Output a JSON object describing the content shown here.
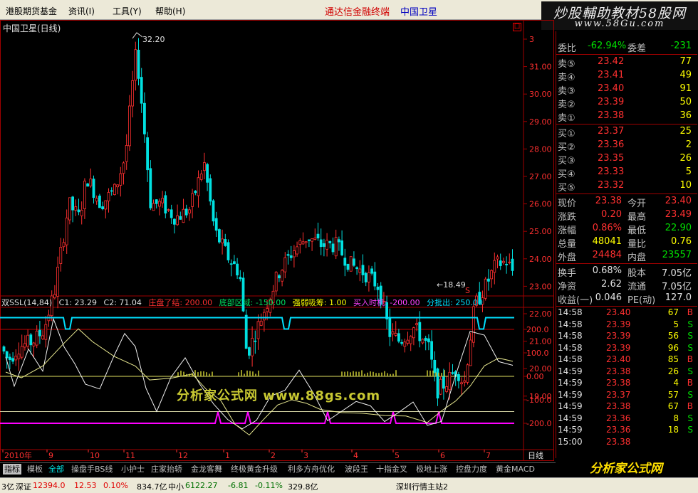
{
  "menu": {
    "items": [
      "港股期货基金",
      "资讯(I)",
      "工具(Y)",
      "帮助(H)"
    ],
    "title_left": "通达信金融终端",
    "title_right": "中国卫星"
  },
  "brand": {
    "line1": "炒股輔助教材58股网",
    "line2": "www.58Gu.com"
  },
  "chart": {
    "title": "中国卫星(日线)",
    "box_label": "口",
    "high_label": "32.20",
    "low_label": "←18.49",
    "s_label": "S",
    "price_ticks": [
      "3",
      "31.00",
      "30.00",
      "29.00",
      "28.00",
      "27.00",
      "26.00",
      "25.00",
      "24.00",
      "23.00",
      "22.00",
      "21.00",
      "20.00",
      "19.00"
    ],
    "ind_ticks": [
      "200.0",
      "100.0",
      "0.00",
      "-100.0",
      "-200.0"
    ],
    "date_labels": [
      "2010年",
      "9",
      "10",
      "11",
      "12",
      "1",
      "2",
      "3",
      "4",
      "5",
      "6",
      "7"
    ],
    "period_label": "日线",
    "colors": {
      "up": "#ff3030",
      "down": "#00e0e0",
      "cyan_line": "#00e0ff",
      "magenta_line": "#ff00ff",
      "yellow_line": "#e0e060",
      "red_line": "#c00000"
    }
  },
  "indicator": {
    "name": "双SSL(14,84)",
    "c1": "C1: 23.29",
    "c2": "C2: 71.04",
    "l1": "庄盘了结: 200.00",
    "l2": "底部区域: -150.00",
    "l3": "强弱吸筹: 1.00",
    "l4": "买入时机: -200.00",
    "l5": "分批出: 250.00"
  },
  "watermark": "分析家公式网 www.88gs.com",
  "chart_data": {
    "type": "candlestick",
    "title": "中国卫星(日线)",
    "ylim": [
      18.49,
      32.2
    ],
    "high": 32.2,
    "low": 18.49,
    "x_labels": [
      "2010年",
      "9",
      "10",
      "11",
      "12",
      "1",
      "2",
      "3",
      "4",
      "5",
      "6",
      "7"
    ],
    "indicator": {
      "name": "双SSL(14,84)",
      "ylim": [
        -250,
        250
      ],
      "levels": [
        250,
        200,
        0,
        -150,
        -200
      ]
    }
  },
  "tabs": [
    "指标",
    "模板",
    "全部",
    "操盘手BS线",
    "小护士",
    "庄家抬轿",
    "金龙客舞",
    "终极黄金升级",
    "利多方舟优化",
    "波段王",
    "十指金叉",
    "极地上涨",
    "控盘力度",
    "黄金MACD"
  ],
  "status": {
    "s0": "3亿",
    "s1_label": "深证",
    "s1_val": "12394.0",
    "s1_chg": "12.53",
    "s1_pct": "0.10%",
    "s1_amt": "834.7亿",
    "s2_label": "中小",
    "s2_val": "6122.27",
    "s2_chg": "-6.81",
    "s2_pct": "-0.11%",
    "s2_amt": "329.8亿",
    "station": "深圳行情主站2"
  },
  "logo": "分析家公式网",
  "quote": {
    "weibi": {
      "label": "委比",
      "val": "-62.94%",
      "label2": "委差",
      "val2": "-231"
    },
    "asks": [
      {
        "label": "卖⑤",
        "price": "23.42",
        "vol": "77"
      },
      {
        "label": "卖④",
        "price": "23.41",
        "vol": "49"
      },
      {
        "label": "卖③",
        "price": "23.40",
        "vol": "91"
      },
      {
        "label": "卖②",
        "price": "23.39",
        "vol": "50"
      },
      {
        "label": "卖①",
        "price": "23.38",
        "vol": "36"
      }
    ],
    "bids": [
      {
        "label": "买①",
        "price": "23.37",
        "vol": "25"
      },
      {
        "label": "买②",
        "price": "23.36",
        "vol": "2"
      },
      {
        "label": "买③",
        "price": "23.35",
        "vol": "26"
      },
      {
        "label": "买④",
        "price": "23.33",
        "vol": "5"
      },
      {
        "label": "买⑤",
        "price": "23.32",
        "vol": "10"
      }
    ],
    "stats": [
      {
        "l1": "现价",
        "v1": "23.38",
        "c1": "q-red",
        "l2": "今开",
        "v2": "23.40",
        "c2": "q-red"
      },
      {
        "l1": "涨跌",
        "v1": "0.20",
        "c1": "q-red",
        "l2": "最高",
        "v2": "23.49",
        "c2": "q-red"
      },
      {
        "l1": "涨幅",
        "v1": "0.86%",
        "c1": "q-red",
        "l2": "最低",
        "v2": "22.90",
        "c2": "q-grn"
      },
      {
        "l1": "总量",
        "v1": "48041",
        "c1": "q-yel",
        "l2": "量比",
        "v2": "0.76",
        "c2": "q-yel"
      },
      {
        "l1": "外盘",
        "v1": "24484",
        "c1": "q-red",
        "l2": "内盘",
        "v2": "23557",
        "c2": "q-grn"
      }
    ],
    "stats2": [
      {
        "l1": "换手",
        "v1": "0.68%",
        "l2": "股本",
        "v2": "7.05亿"
      },
      {
        "l1": "净资",
        "v1": "2.62",
        "l2": "流通",
        "v2": "7.05亿"
      },
      {
        "l1": "收益(一)",
        "v1": "0.046",
        "l2": "PE(动)",
        "v2": "127.0"
      }
    ],
    "ticks": [
      {
        "t": "14:58",
        "p": "23.40",
        "v": "67",
        "s": "B"
      },
      {
        "t": "14:58",
        "p": "23.39",
        "v": "5",
        "s": "S"
      },
      {
        "t": "14:58",
        "p": "23.39",
        "v": "56",
        "s": "S"
      },
      {
        "t": "14:58",
        "p": "23.39",
        "v": "96",
        "s": "S"
      },
      {
        "t": "14:58",
        "p": "23.40",
        "v": "85",
        "s": "B"
      },
      {
        "t": "14:59",
        "p": "23.38",
        "v": "26",
        "s": "S"
      },
      {
        "t": "14:59",
        "p": "23.38",
        "v": "4",
        "s": "B"
      },
      {
        "t": "14:59",
        "p": "23.37",
        "v": "57",
        "s": "S"
      },
      {
        "t": "14:59",
        "p": "23.38",
        "v": "67",
        "s": "B"
      },
      {
        "t": "14:59",
        "p": "23.36",
        "v": "8",
        "s": "S"
      },
      {
        "t": "14:59",
        "p": "23.36",
        "v": "18",
        "s": "S"
      },
      {
        "t": "15:00",
        "p": "23.38",
        "v": "",
        "s": ""
      }
    ]
  }
}
